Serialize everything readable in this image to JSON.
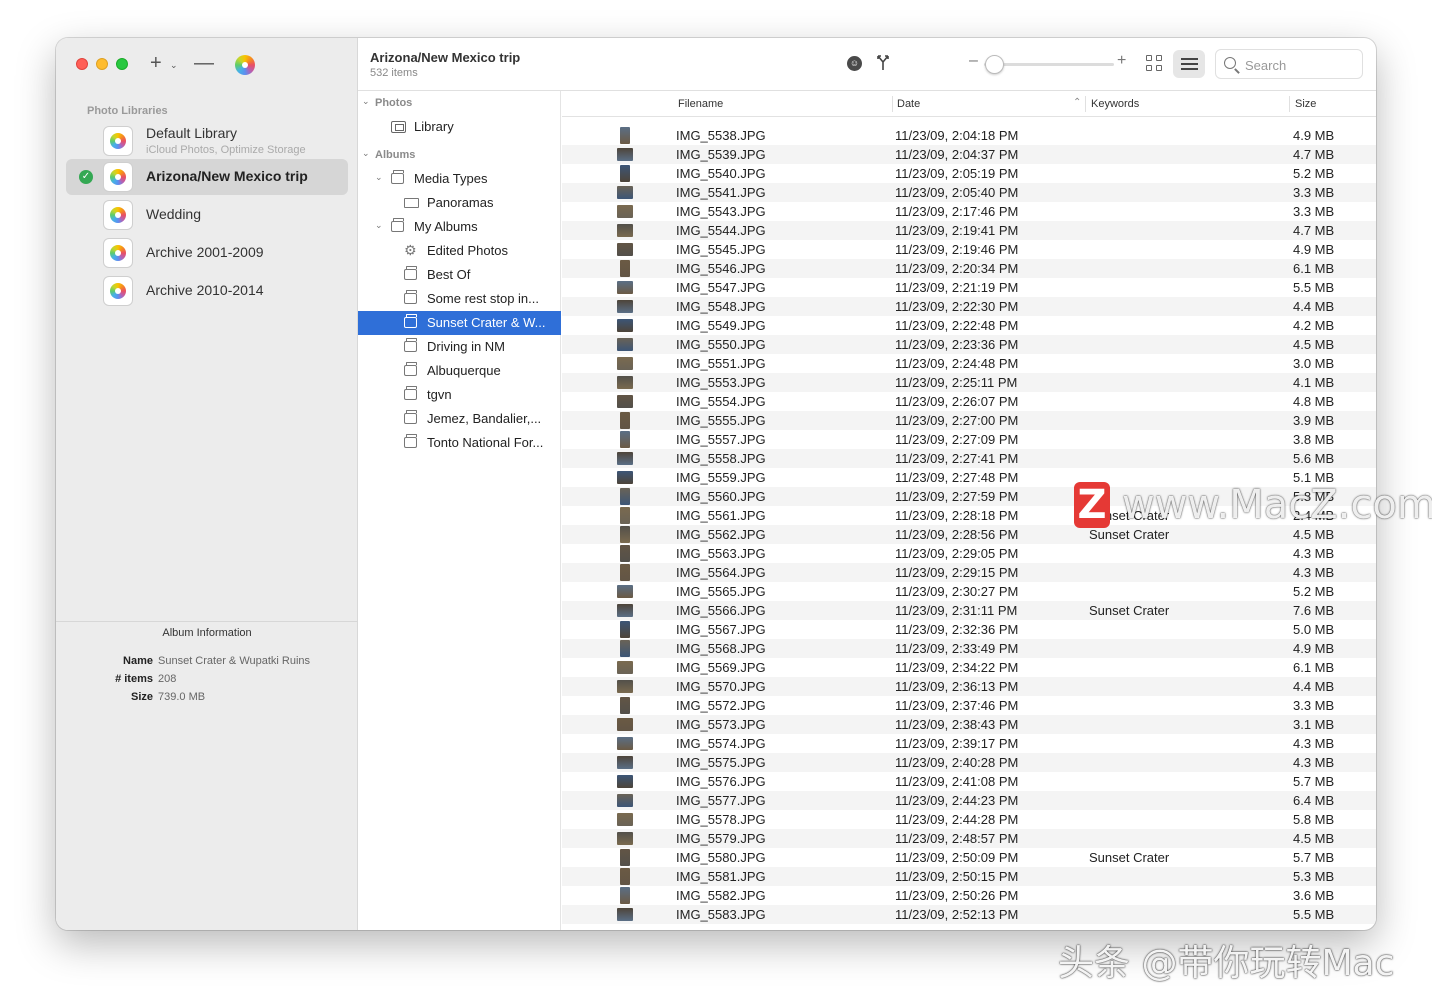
{
  "sidebar": {
    "section_label": "Photo Libraries",
    "libraries": [
      {
        "name": "Default Library",
        "subtitle": "iCloud Photos, Optimize Storage",
        "selected": false
      },
      {
        "name": "Arizona/New Mexico trip",
        "subtitle": "",
        "selected": true
      },
      {
        "name": "Wedding",
        "subtitle": "",
        "selected": false
      },
      {
        "name": "Archive 2001-2009",
        "subtitle": "",
        "selected": false
      },
      {
        "name": "Archive 2010-2014",
        "subtitle": "",
        "selected": false
      }
    ],
    "album_info": {
      "title": "Album Information",
      "name_label": "Name",
      "name_value": "Sunset Crater & Wupatki Ruins",
      "items_label": "# items",
      "items_value": "208",
      "size_label": "Size",
      "size_value": "739.0 MB"
    }
  },
  "toolbar": {
    "title": "Arizona/New Mexico trip",
    "subtitle": "532 items",
    "search_placeholder": "Search"
  },
  "tree": [
    {
      "label": "Photos",
      "type": "section",
      "arrow": true,
      "indent": 0
    },
    {
      "label": "Library",
      "type": "library",
      "indent": 1
    },
    {
      "label": "Albums",
      "type": "section",
      "arrow": true,
      "indent": 0
    },
    {
      "label": "Media Types",
      "type": "folder",
      "arrow": true,
      "indent": 1
    },
    {
      "label": "Panoramas",
      "type": "pano",
      "indent": 2
    },
    {
      "label": "My Albums",
      "type": "folder",
      "arrow": true,
      "indent": 1
    },
    {
      "label": "Edited Photos",
      "type": "gear",
      "indent": 2
    },
    {
      "label": "Best Of",
      "type": "album",
      "indent": 2
    },
    {
      "label": "Some rest stop in...",
      "type": "album",
      "indent": 2
    },
    {
      "label": "Sunset Crater & W...",
      "type": "album",
      "indent": 2,
      "selected": true
    },
    {
      "label": "Driving in NM",
      "type": "album",
      "indent": 2
    },
    {
      "label": "Albuquerque",
      "type": "album",
      "indent": 2
    },
    {
      "label": "tgvn",
      "type": "album",
      "indent": 2
    },
    {
      "label": "Jemez, Bandalier,...",
      "type": "album",
      "indent": 2
    },
    {
      "label": "Tonto National For...",
      "type": "album",
      "indent": 2
    }
  ],
  "table": {
    "columns": {
      "filename": "Filename",
      "date": "Date",
      "keywords": "Keywords",
      "size": "Size"
    },
    "rows": [
      {
        "filename": "IMG_5538.JPG",
        "date": "11/23/09, 2:04:18 PM",
        "keywords": "",
        "size": "4.9 MB"
      },
      {
        "filename": "IMG_5539.JPG",
        "date": "11/23/09, 2:04:37 PM",
        "keywords": "",
        "size": "4.7 MB"
      },
      {
        "filename": "IMG_5540.JPG",
        "date": "11/23/09, 2:05:19 PM",
        "keywords": "",
        "size": "5.2 MB"
      },
      {
        "filename": "IMG_5541.JPG",
        "date": "11/23/09, 2:05:40 PM",
        "keywords": "",
        "size": "3.3 MB"
      },
      {
        "filename": "IMG_5543.JPG",
        "date": "11/23/09, 2:17:46 PM",
        "keywords": "",
        "size": "3.3 MB"
      },
      {
        "filename": "IMG_5544.JPG",
        "date": "11/23/09, 2:19:41 PM",
        "keywords": "",
        "size": "4.7 MB"
      },
      {
        "filename": "IMG_5545.JPG",
        "date": "11/23/09, 2:19:46 PM",
        "keywords": "",
        "size": "4.9 MB"
      },
      {
        "filename": "IMG_5546.JPG",
        "date": "11/23/09, 2:20:34 PM",
        "keywords": "",
        "size": "6.1 MB"
      },
      {
        "filename": "IMG_5547.JPG",
        "date": "11/23/09, 2:21:19 PM",
        "keywords": "",
        "size": "5.5 MB"
      },
      {
        "filename": "IMG_5548.JPG",
        "date": "11/23/09, 2:22:30 PM",
        "keywords": "",
        "size": "4.4 MB"
      },
      {
        "filename": "IMG_5549.JPG",
        "date": "11/23/09, 2:22:48 PM",
        "keywords": "",
        "size": "4.2 MB"
      },
      {
        "filename": "IMG_5550.JPG",
        "date": "11/23/09, 2:23:36 PM",
        "keywords": "",
        "size": "4.5 MB"
      },
      {
        "filename": "IMG_5551.JPG",
        "date": "11/23/09, 2:24:48 PM",
        "keywords": "",
        "size": "3.0 MB"
      },
      {
        "filename": "IMG_5553.JPG",
        "date": "11/23/09, 2:25:11 PM",
        "keywords": "",
        "size": "4.1 MB"
      },
      {
        "filename": "IMG_5554.JPG",
        "date": "11/23/09, 2:26:07 PM",
        "keywords": "",
        "size": "4.8 MB"
      },
      {
        "filename": "IMG_5555.JPG",
        "date": "11/23/09, 2:27:00 PM",
        "keywords": "",
        "size": "3.9 MB"
      },
      {
        "filename": "IMG_5557.JPG",
        "date": "11/23/09, 2:27:09 PM",
        "keywords": "",
        "size": "3.8 MB"
      },
      {
        "filename": "IMG_5558.JPG",
        "date": "11/23/09, 2:27:41 PM",
        "keywords": "",
        "size": "5.6 MB"
      },
      {
        "filename": "IMG_5559.JPG",
        "date": "11/23/09, 2:27:48 PM",
        "keywords": "",
        "size": "5.1 MB"
      },
      {
        "filename": "IMG_5560.JPG",
        "date": "11/23/09, 2:27:59 PM",
        "keywords": "",
        "size": "5.8 MB"
      },
      {
        "filename": "IMG_5561.JPG",
        "date": "11/23/09, 2:28:18 PM",
        "keywords": "Sunset Crater",
        "size": "2.4 MB"
      },
      {
        "filename": "IMG_5562.JPG",
        "date": "11/23/09, 2:28:56 PM",
        "keywords": "Sunset Crater",
        "size": "4.5 MB"
      },
      {
        "filename": "IMG_5563.JPG",
        "date": "11/23/09, 2:29:05 PM",
        "keywords": "",
        "size": "4.3 MB"
      },
      {
        "filename": "IMG_5564.JPG",
        "date": "11/23/09, 2:29:15 PM",
        "keywords": "",
        "size": "4.3 MB"
      },
      {
        "filename": "IMG_5565.JPG",
        "date": "11/23/09, 2:30:27 PM",
        "keywords": "",
        "size": "5.2 MB"
      },
      {
        "filename": "IMG_5566.JPG",
        "date": "11/23/09, 2:31:11 PM",
        "keywords": "Sunset Crater",
        "size": "7.6 MB"
      },
      {
        "filename": "IMG_5567.JPG",
        "date": "11/23/09, 2:32:36 PM",
        "keywords": "",
        "size": "5.0 MB"
      },
      {
        "filename": "IMG_5568.JPG",
        "date": "11/23/09, 2:33:49 PM",
        "keywords": "",
        "size": "4.9 MB"
      },
      {
        "filename": "IMG_5569.JPG",
        "date": "11/23/09, 2:34:22 PM",
        "keywords": "",
        "size": "6.1 MB"
      },
      {
        "filename": "IMG_5570.JPG",
        "date": "11/23/09, 2:36:13 PM",
        "keywords": "",
        "size": "4.4 MB"
      },
      {
        "filename": "IMG_5572.JPG",
        "date": "11/23/09, 2:37:46 PM",
        "keywords": "",
        "size": "3.3 MB"
      },
      {
        "filename": "IMG_5573.JPG",
        "date": "11/23/09, 2:38:43 PM",
        "keywords": "",
        "size": "3.1 MB"
      },
      {
        "filename": "IMG_5574.JPG",
        "date": "11/23/09, 2:39:17 PM",
        "keywords": "",
        "size": "4.3 MB"
      },
      {
        "filename": "IMG_5575.JPG",
        "date": "11/23/09, 2:40:28 PM",
        "keywords": "",
        "size": "4.3 MB"
      },
      {
        "filename": "IMG_5576.JPG",
        "date": "11/23/09, 2:41:08 PM",
        "keywords": "",
        "size": "5.7 MB"
      },
      {
        "filename": "IMG_5577.JPG",
        "date": "11/23/09, 2:44:23 PM",
        "keywords": "",
        "size": "6.4 MB"
      },
      {
        "filename": "IMG_5578.JPG",
        "date": "11/23/09, 2:44:28 PM",
        "keywords": "",
        "size": "5.8 MB"
      },
      {
        "filename": "IMG_5579.JPG",
        "date": "11/23/09, 2:48:57 PM",
        "keywords": "",
        "size": "4.5 MB"
      },
      {
        "filename": "IMG_5580.JPG",
        "date": "11/23/09, 2:50:09 PM",
        "keywords": "Sunset Crater",
        "size": "5.7 MB"
      },
      {
        "filename": "IMG_5581.JPG",
        "date": "11/23/09, 2:50:15 PM",
        "keywords": "",
        "size": "5.3 MB"
      },
      {
        "filename": "IMG_5582.JPG",
        "date": "11/23/09, 2:50:26 PM",
        "keywords": "",
        "size": "3.6 MB"
      },
      {
        "filename": "IMG_5583.JPG",
        "date": "11/23/09, 2:52:13 PM",
        "keywords": "",
        "size": "5.5 MB"
      }
    ]
  },
  "watermark": {
    "site": "www.MacZ.com",
    "logo_letter": "Z",
    "credit": "头条 @带你玩转Mac"
  },
  "colors": {
    "selection": "#2f6fd8",
    "sidebar_bg": "#ececec",
    "check_green": "#34a853"
  }
}
